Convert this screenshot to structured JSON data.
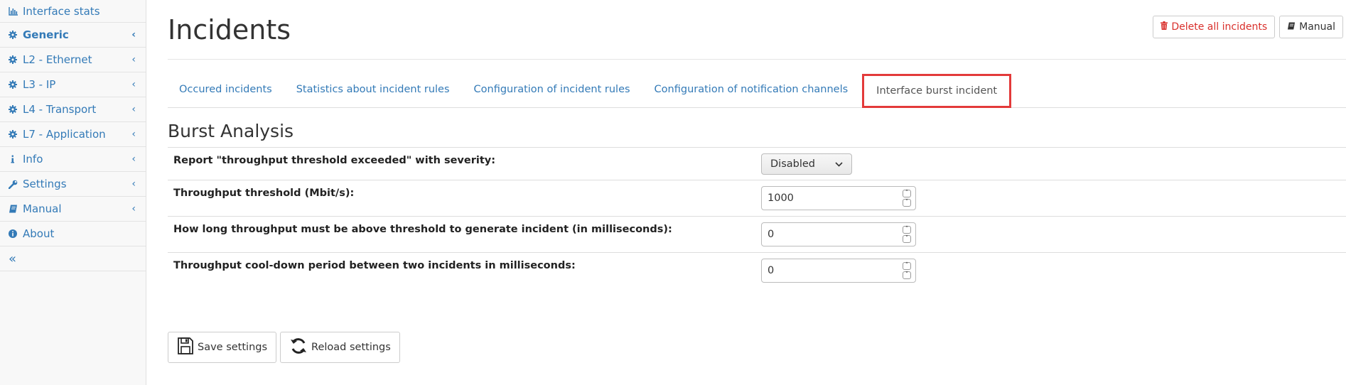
{
  "sidebar": {
    "items": [
      {
        "label": "Interface stats",
        "icon": "bar-chart-icon",
        "chevron": false
      },
      {
        "label": "Generic",
        "icon": "gear-icon",
        "chevron": true
      },
      {
        "label": "L2 - Ethernet",
        "icon": "gear-icon",
        "chevron": true
      },
      {
        "label": "L3 - IP",
        "icon": "gear-icon",
        "chevron": true
      },
      {
        "label": "L4 - Transport",
        "icon": "gear-icon",
        "chevron": true
      },
      {
        "label": "L7 - Application",
        "icon": "gear-icon",
        "chevron": true
      },
      {
        "label": "Info",
        "icon": "info-icon",
        "chevron": true
      },
      {
        "label": "Settings",
        "icon": "wrench-icon",
        "chevron": true
      },
      {
        "label": "Manual",
        "icon": "book-icon",
        "chevron": true
      },
      {
        "label": "About",
        "icon": "info-circle-icon",
        "chevron": false
      }
    ],
    "collapse_glyph": "«",
    "chevron_glyph": "‹"
  },
  "header": {
    "title": "Incidents",
    "delete_all_label": "Delete all incidents",
    "manual_label": "Manual"
  },
  "tabs": [
    {
      "label": "Occured incidents",
      "active": false
    },
    {
      "label": "Statistics about incident rules",
      "active": false
    },
    {
      "label": "Configuration of incident rules",
      "active": false
    },
    {
      "label": "Configuration of notification channels",
      "active": false
    },
    {
      "label": "Interface burst incident",
      "active": true
    }
  ],
  "section": {
    "title": "Burst Analysis"
  },
  "settings": {
    "severity": {
      "label": "Report \"throughput threshold exceeded\" with severity:",
      "value": "Disabled"
    },
    "threshold": {
      "label": "Throughput threshold (Mbit/s):",
      "value": "1000"
    },
    "duration": {
      "label": "How long throughput must be above threshold to generate incident (in milliseconds):",
      "value": "0"
    },
    "cooldown": {
      "label": "Throughput cool-down period between two incidents in milliseconds:",
      "value": "0"
    }
  },
  "actions": {
    "save_label": "Save settings",
    "reload_label": "Reload settings"
  },
  "colors": {
    "link": "#337ab7",
    "danger": "#d9302c",
    "highlight": "#e33a3a"
  }
}
